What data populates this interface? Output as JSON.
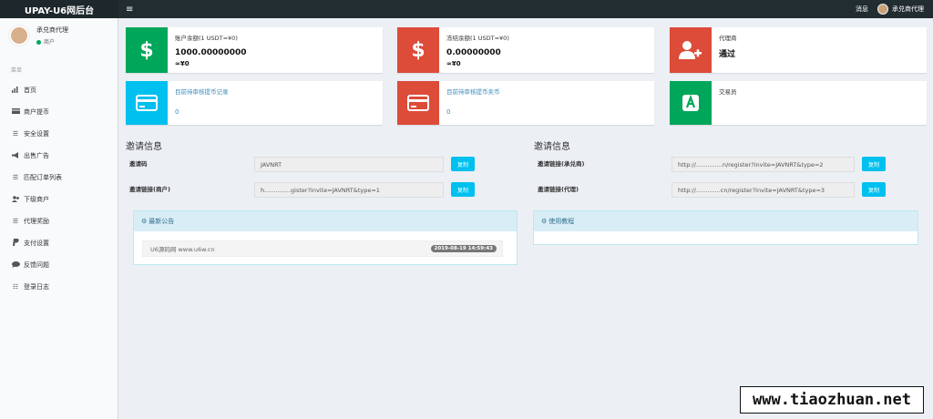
{
  "topbar": {
    "logo": "UPAY-U6网后台",
    "toggle_icon": "≡",
    "messages": "消息",
    "username": "承兑商代理"
  },
  "sidebar": {
    "user_name": "承兑商代理",
    "user_status": "商户",
    "menu_header": "菜单",
    "items": [
      {
        "label": "首页",
        "icon": "bar-chart-icon"
      },
      {
        "label": "商户提币",
        "icon": "card-icon"
      },
      {
        "label": "安全设置",
        "icon": "list-icon"
      },
      {
        "label": "出售广告",
        "icon": "megaphone-icon"
      },
      {
        "label": "匹配订单列表",
        "icon": "list-icon"
      },
      {
        "label": "下级商户",
        "icon": "users-icon"
      },
      {
        "label": "代理奖励",
        "icon": "list-icon"
      },
      {
        "label": "支付设置",
        "icon": "paypal-icon"
      },
      {
        "label": "反馈问题",
        "icon": "comment-icon"
      },
      {
        "label": "登录日志",
        "icon": "list-icon"
      }
    ]
  },
  "cards": {
    "balance": {
      "label": "账户余额(1 USDT=¥0)",
      "value": "1000.00000000",
      "sub": "≈¥0",
      "color": "#00a65a"
    },
    "frozen": {
      "label": "冻结余额(1 USDT=¥0)",
      "value": "0.00000000",
      "sub": "≈¥0",
      "color": "#dd4b39"
    },
    "agent": {
      "label": "代理商",
      "value": "通过",
      "color": "#dd4b39"
    },
    "pending_withdraw": {
      "label": "目前待审核提币记录",
      "value": "0",
      "color": "#00c0ef"
    },
    "pending_sell": {
      "label": "目前待审核提币卖币",
      "value": "0",
      "color": "#dd4b39"
    },
    "trader": {
      "label": "交易员",
      "color": "#00a65a"
    }
  },
  "invite_left": {
    "title": "邀请信息",
    "code_label": "邀请码",
    "code_value": "JAVNRT",
    "link_label": "邀请链接(商户)",
    "link_value": "h..............gister?invite=JAVNRT&type=1",
    "copy": "复制"
  },
  "invite_right": {
    "title": "邀请信息",
    "link1_label": "邀请链接(承兑商)",
    "link1_value": "http://..............n/register?invite=JAVNRT&type=2",
    "link2_label": "邀请链接(代理)",
    "link2_value": "http://.............cn/register?invite=JAVNRT&type=3",
    "copy": "复制"
  },
  "announcement": {
    "title": "最新公告",
    "item_text": "U6源码网 www.u6w.cn",
    "item_date": "2019-08-19 14:59:43"
  },
  "tutorial": {
    "title": "使用教程"
  },
  "watermark": "www.tiaozhuan.net"
}
